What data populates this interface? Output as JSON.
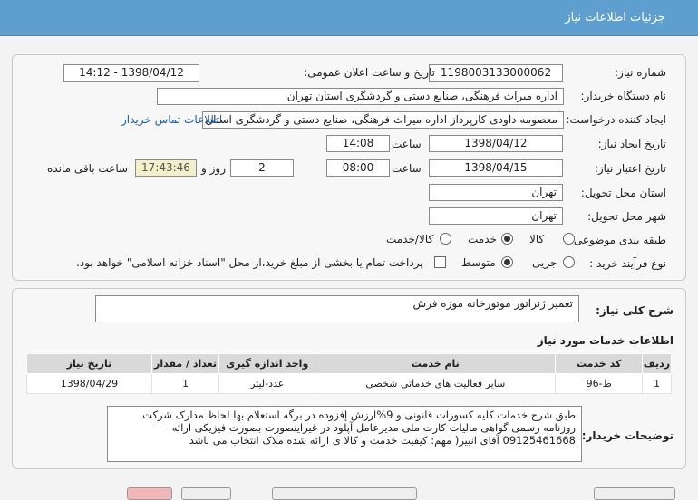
{
  "header": {
    "title": "جزئیات اطلاعات نیاز"
  },
  "form": {
    "need_number_label": "شماره نیاز:",
    "need_number": "1198003133000062",
    "announce_label": "تاریخ و ساعت اعلان عمومی:",
    "announce_value": "1398/04/12 - 14:12",
    "buyer_org_label": "نام دستگاه خریدار:",
    "buyer_org": "اداره میراث فرهنگی، صنایع دستی و گردشگری استان تهران",
    "requester_label": "ایجاد کننده درخواست:",
    "requester": "معصومه داودی کارپرداز اداره میراث فرهنگی، صنایع دستی و گردشگری استان تهران",
    "contact_link": "اطلاعات تماس خریدار",
    "created_label": "تاریخ ایجاد نیاز:",
    "created_date": "1398/04/12",
    "time_label": "ساعت",
    "created_time": "14:08",
    "validity_label": "تاریخ اعتبار نیاز:",
    "validity_date": "1398/04/15",
    "validity_time": "08:00",
    "days": "2",
    "days_label": "روز و",
    "remaining_time": "17:43:46",
    "remaining_label": "ساعت باقی مانده",
    "province_label": "استان محل تحویل:",
    "province": "تهران",
    "city_label": "شهر محل تحویل:",
    "city": "تهران",
    "category_label": "طبقه بندی موضوعی:",
    "category_options": [
      "کالا",
      "خدمت",
      "کالا/خدمت"
    ],
    "process_label": "نوع فرآیند خرید :",
    "process_options": [
      "جزیی",
      "متوسط"
    ],
    "payment_note": "پرداخت تمام یا بخشی از مبلغ خرید،از محل \"اسناد خزانه اسلامی\" خواهد بود."
  },
  "summary": {
    "label": "شرح کلی نیاز:",
    "value": "تعمیر ژنراتور موتورخانه موزه فرش"
  },
  "services": {
    "heading": "اطلاعات خدمات مورد نیاز",
    "columns": [
      "ردیف",
      "کد خدمت",
      "نام خدمت",
      "واحد اندازه گیری",
      "تعداد / مقدار",
      "تاریخ نیاز"
    ],
    "rows": [
      [
        "1",
        "ط-96",
        "سایر فعالیت های خدماتی شخصی",
        "عدد-لیتر",
        "1",
        "1398/04/29"
      ]
    ]
  },
  "buyer_notes": {
    "label": "توضیحات خریدار:",
    "lines": [
      "طبق شرح خدمات کلیه کسورات قانونی و 9%ارزش إفزوده در برگه استعلام بها لحاظ مدارک شرکت",
      "روزنامه رسمی گواهی مالیات  کارت ملی مدیرعامل آپلود در غیراینصورت بصورت فیزیکی ارائه",
      "09125461668 آقای انبیر( مهم: کیفیت خدمت و کالا ی ارائه شده ملاک انتخاب می باشد"
    ]
  },
  "colors": {
    "header_bg": "#5f9fd0",
    "link": "#1a5fb4"
  }
}
